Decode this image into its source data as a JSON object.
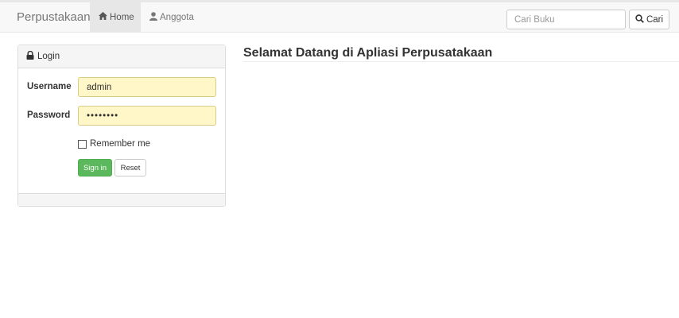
{
  "navbar": {
    "brand": "Perpustakaan",
    "items": [
      {
        "label": "Home",
        "icon": "home-icon",
        "active": true
      },
      {
        "label": "Anggota",
        "icon": "user-icon",
        "active": false
      }
    ],
    "search": {
      "placeholder": "Cari Buku",
      "button_label": "Cari",
      "icon": "search-icon"
    }
  },
  "login_panel": {
    "title": "Login",
    "title_icon": "lock-icon",
    "username_label": "Username",
    "username_value": "admin",
    "password_label": "Password",
    "password_value": "••••••••",
    "remember_label": "Remember me",
    "remember_checked": false,
    "signin_label": "Sign in",
    "reset_label": "Reset"
  },
  "main": {
    "title": "Selamat Datang di Apliasi Perpusatakaan"
  },
  "colors": {
    "navbar_bg": "#f8f8f8",
    "active_nav_bg": "#e7e7e7",
    "autofill_bg": "#fff7c8",
    "signin_green": "#5cb85c"
  }
}
